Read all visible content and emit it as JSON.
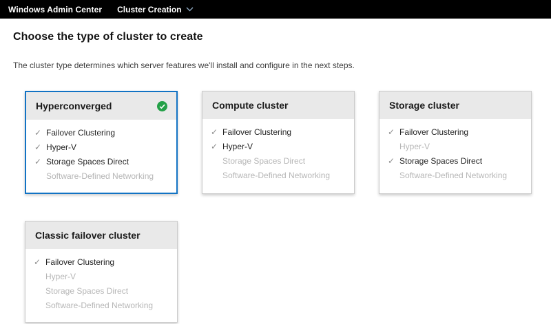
{
  "topbar": {
    "app_title": "Windows Admin Center",
    "tool_title": "Cluster Creation"
  },
  "page": {
    "title": "Choose the type of cluster to create",
    "subtitle": "The cluster type determines which server features we'll install and configure in the next steps."
  },
  "icons": {
    "check_glyph": "✓",
    "chevron_down": "chevron-down-icon",
    "selected_badge": "green-circle-check-icon"
  },
  "colors": {
    "topbar_bg": "#000000",
    "topbar_text": "#ffffff",
    "chevron": "#8fa9c2",
    "selected_border": "#1273c4",
    "card_border": "#cbcbcb",
    "card_header_bg": "#e9e9e9",
    "badge_green": "#23a047",
    "check_gray": "#8c8c8c",
    "feature_text": "#262626",
    "feature_disabled_text": "#b6b6b6"
  },
  "cards": [
    {
      "title": "Hyperconverged",
      "selected": true,
      "features": [
        {
          "label": "Failover Clustering",
          "included": true
        },
        {
          "label": "Hyper-V",
          "included": true
        },
        {
          "label": "Storage Spaces Direct",
          "included": true
        },
        {
          "label": "Software-Defined Networking",
          "included": false
        }
      ]
    },
    {
      "title": "Compute cluster",
      "selected": false,
      "features": [
        {
          "label": "Failover Clustering",
          "included": true
        },
        {
          "label": "Hyper-V",
          "included": true
        },
        {
          "label": "Storage Spaces Direct",
          "included": false
        },
        {
          "label": "Software-Defined Networking",
          "included": false
        }
      ]
    },
    {
      "title": "Storage cluster",
      "selected": false,
      "features": [
        {
          "label": "Failover Clustering",
          "included": true
        },
        {
          "label": "Hyper-V",
          "included": false
        },
        {
          "label": "Storage Spaces Direct",
          "included": true
        },
        {
          "label": "Software-Defined Networking",
          "included": false
        }
      ]
    },
    {
      "title": "Classic failover cluster",
      "selected": false,
      "features": [
        {
          "label": "Failover Clustering",
          "included": true
        },
        {
          "label": "Hyper-V",
          "included": false
        },
        {
          "label": "Storage Spaces Direct",
          "included": false
        },
        {
          "label": "Software-Defined Networking",
          "included": false
        }
      ]
    }
  ]
}
